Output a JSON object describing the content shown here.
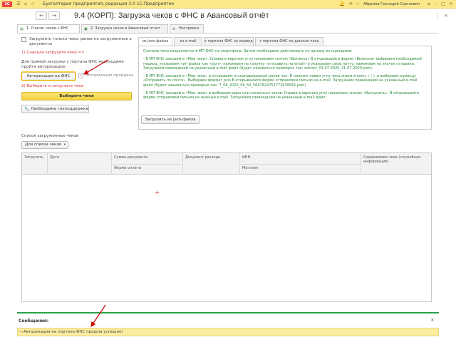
{
  "titlebar": {
    "logo": "1С",
    "app_title": "Бухгалтерия предприятия, редакция 3.0 1С:Предприятие",
    "user": "Абрамов Геннадий Сергеевич"
  },
  "navbar": {
    "back": "←",
    "forward": "→",
    "form_title": "9.4 (КОРП): Загрузка чеков с ФНС в Авансовый отчёт",
    "more": "⋮",
    "close": "×"
  },
  "tabs": [
    {
      "label": "1. Список чеков с ФНС"
    },
    {
      "label": "2. Загрузка чеков в Авансовый отчет"
    },
    {
      "label": "Настройки"
    }
  ],
  "left": {
    "only_not_loaded": "Загружать только чеки, ранее не загруженные в документы",
    "first_load": "1) Сначала загрузите чеки =>",
    "auth_note": "Для прямой загрузки с портала ФНС необходимо пройти авторизацию:",
    "auth_button": "Авторизация на ФНС",
    "auth_done": "Авторизация пройдена",
    "choose_link": "2) Выберите и загрузите чеки",
    "choose_button": "Выберите чеки",
    "tech_button": "Необходима техподдержка"
  },
  "subtabs": [
    {
      "label": "из json-файла"
    },
    {
      "label": "из e-mail"
    },
    {
      "label": "с портала ФНС за период"
    },
    {
      "label": "с портала ФНС по данным чека"
    }
  ],
  "info": {
    "p1": "Сначала чеки сохраняются в МП ФНС на смартфоне. Затем необходимо действовать по одному из сценариев:",
    "p2": "- В МП ФНС заходим в «Мои чеки». Справа в верхнем углу нажимаем значок «Выписка» В открывшейся форме «Выписка» выбираем необходимый период, указываем тип файла как «json», нажимаем на галочку «отправить на email» и указываем свою почту, нажимаем на значок отправки. Загружаем пришедший на указанный e-mail файл (будет называться примерно так: extract_01-07-2020_21-07-2020.json).",
    "p3": "- В МП ФНС заходим в «Мои чеки» и открываем отсканированный ранее чек. В нижнем левом углу чека жмем кнопку «⋮» и выбираем команду «Отправить по почте». Выбираем формат json В открывшейся форме отправляем письмо на e-mail. Загружаем пришедший на указанный e-mail файл (будет называться примерно так: 7_08_2020_09_50_5647824751773939561.json).",
    "p4": "- В МП ФНС заходим в «Мои чеки» и выбираем один или несколько чеков. Справа в верхнем углу нажимаем значок «Выгрузить». В открывшейся форме отправляем письмо на нужный e-mail. Загружаем пришедший на указанный e-mail файл.",
    "json_button": "Загрузить из json-файла"
  },
  "list": {
    "label": "Список загруженных чеков",
    "select_value": "Для списка чеков",
    "columns": {
      "loaded": "Загрузить",
      "date": "Дата",
      "sum": "Сумма документа",
      "payment_form": "Форма оплаты",
      "expense_doc": "Документ расхода",
      "inn": "ИНН",
      "shop": "Магазин",
      "content": "Содержимое чека (служебная информация)"
    }
  },
  "messages": {
    "title": "Сообщения:",
    "close": "×",
    "dash": "—",
    "text": "Авторизация на портале ФНС прошла успешно!"
  },
  "colors": {
    "titlebar": "#fbe88a",
    "accent_yellow": "#f2d13c",
    "info_text": "#2a8a3a",
    "link_red": "#d33333",
    "message_bar": "#fbeea0",
    "divider_green": "#2aa04a"
  }
}
